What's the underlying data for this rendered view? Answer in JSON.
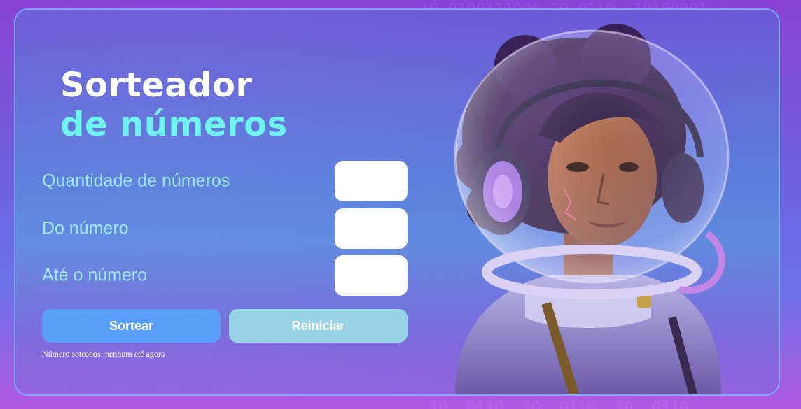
{
  "header": {
    "title_line1": "Sorteador",
    "title_line2": "de números"
  },
  "form": {
    "quantity_label": "Quantidade de números",
    "quantity_value": "",
    "from_label": "Do número",
    "from_value": "",
    "to_label": "Até o número",
    "to_value": ""
  },
  "buttons": {
    "draw_label": "Sortear",
    "reset_label": "Reiniciar"
  },
  "result": {
    "text": "Número soteados: nenhum até agora"
  },
  "colors": {
    "accent_cyan": "#6ff3f1",
    "draw_button": "#5aa0f8",
    "reset_button": "#96d3e6",
    "label_color": "#9fe6ff"
  },
  "illustration": {
    "icon": "astronaut-illustration"
  }
}
